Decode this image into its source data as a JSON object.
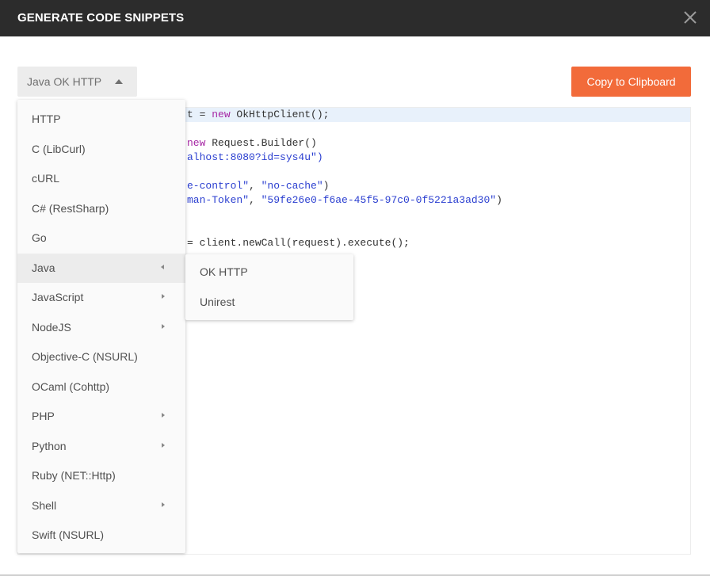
{
  "dialog": {
    "title": "GENERATE CODE SNIPPETS",
    "close_icon": "close-icon"
  },
  "language_select": {
    "value": "Java OK HTTP"
  },
  "copy_button": {
    "label": "Copy to Clipboard",
    "color": "#f26b3a"
  },
  "code_visible_fragments": [
    [
      {
        "t": "t = ",
        "c": ""
      },
      {
        "t": "new",
        "c": "kw"
      },
      {
        "t": " OkHttpClient();",
        "c": ""
      }
    ],
    [],
    [
      {
        "t": "new",
        "c": "kw"
      },
      {
        "t": " Request.Builder()",
        "c": ""
      }
    ],
    [
      {
        "t": "alhost:8080?id=sys4u\")",
        "c": "str"
      }
    ],
    [],
    [
      {
        "t": "e-control\"",
        "c": "str"
      },
      {
        "t": ", ",
        "c": ""
      },
      {
        "t": "\"no-cache\"",
        "c": "str"
      },
      {
        "t": ")",
        "c": ""
      }
    ],
    [
      {
        "t": "man-Token\"",
        "c": "str"
      },
      {
        "t": ", ",
        "c": ""
      },
      {
        "t": "\"59fe26e0-f6ae-45f5-97c0-0f5221a3ad30\"",
        "c": "str"
      },
      {
        "t": ")",
        "c": ""
      }
    ],
    [],
    [],
    [
      {
        "t": "= client.newCall(request).execute();",
        "c": ""
      }
    ]
  ],
  "language_menu": {
    "items": [
      {
        "label": "HTTP",
        "submenu": false
      },
      {
        "label": "C (LibCurl)",
        "submenu": false
      },
      {
        "label": "cURL",
        "submenu": false
      },
      {
        "label": "C# (RestSharp)",
        "submenu": false
      },
      {
        "label": "Go",
        "submenu": false
      },
      {
        "label": "Java",
        "submenu": true,
        "active": true
      },
      {
        "label": "JavaScript",
        "submenu": true
      },
      {
        "label": "NodeJS",
        "submenu": true
      },
      {
        "label": "Objective-C (NSURL)",
        "submenu": false
      },
      {
        "label": "OCaml (Cohttp)",
        "submenu": false
      },
      {
        "label": "PHP",
        "submenu": true
      },
      {
        "label": "Python",
        "submenu": true
      },
      {
        "label": "Ruby (NET::Http)",
        "submenu": false
      },
      {
        "label": "Shell",
        "submenu": true
      },
      {
        "label": "Swift (NSURL)",
        "submenu": false
      }
    ]
  },
  "java_submenu": {
    "items": [
      {
        "label": "OK HTTP"
      },
      {
        "label": "Unirest"
      }
    ]
  }
}
